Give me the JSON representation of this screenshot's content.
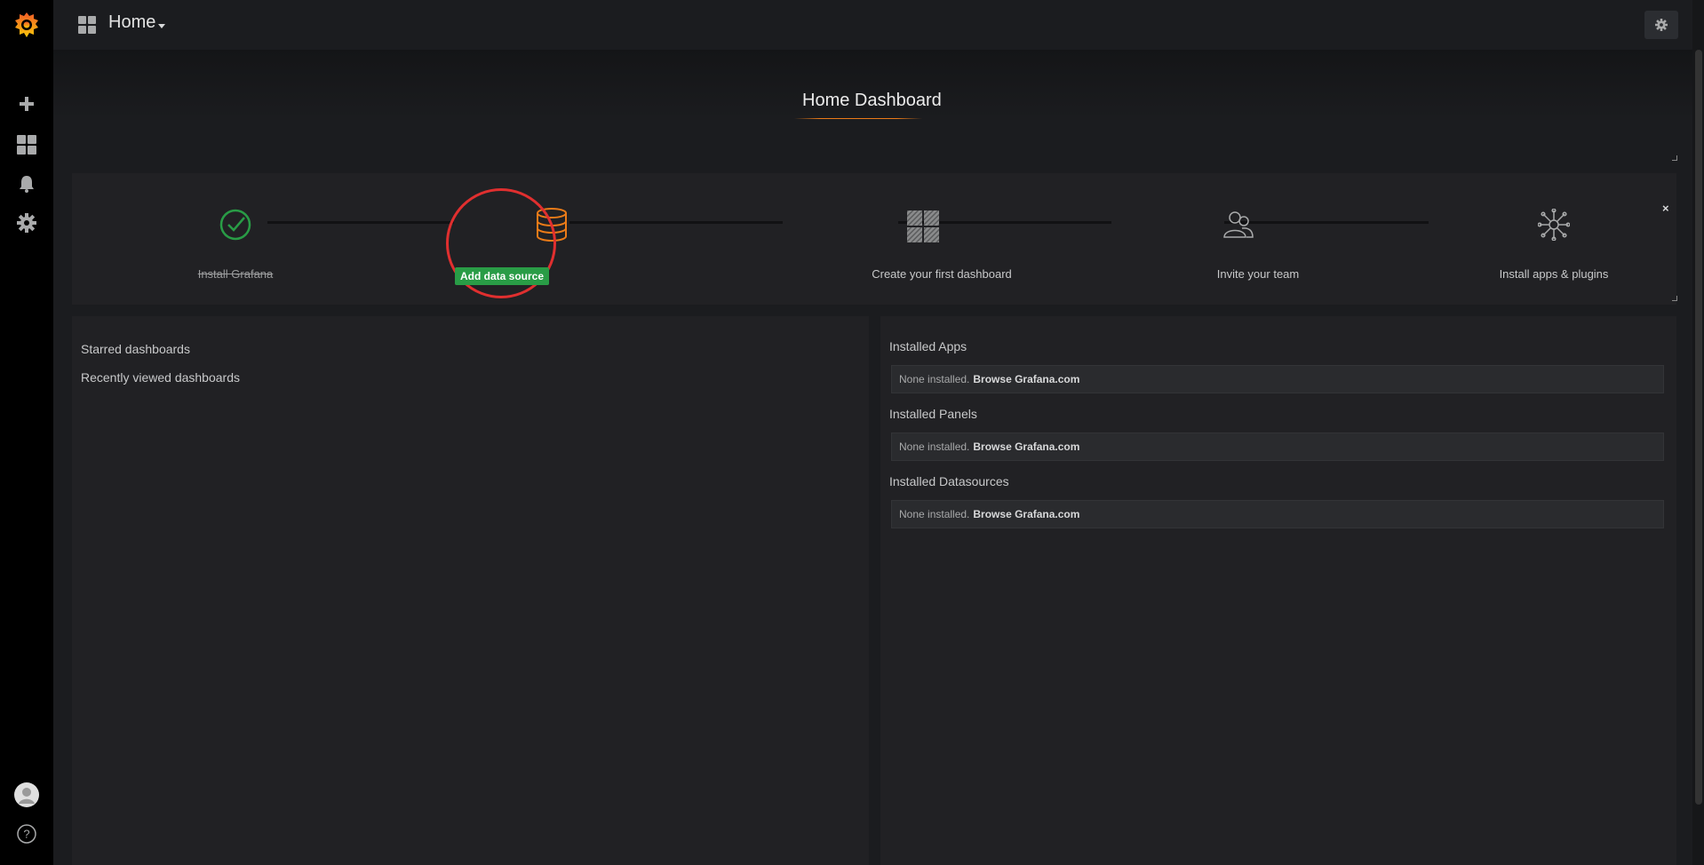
{
  "topbar": {
    "title": "Home"
  },
  "home": {
    "title": "Home Dashboard"
  },
  "onboarding": {
    "steps": [
      {
        "label": "Install Grafana",
        "icon": "check-circle-icon",
        "done": true
      },
      {
        "label": "Add data source",
        "icon": "database-icon",
        "active": true
      },
      {
        "label": "Create your first dashboard",
        "icon": "dashboard-grid-icon"
      },
      {
        "label": "Invite your team",
        "icon": "users-icon"
      },
      {
        "label": "Install apps & plugins",
        "icon": "plugins-icon"
      }
    ],
    "close_label": "×"
  },
  "left_panel": {
    "starred": "Starred dashboards",
    "recent": "Recently viewed dashboards"
  },
  "right_panel": {
    "sections": [
      {
        "title": "Installed Apps",
        "none": "None installed.",
        "link": "Browse Grafana.com"
      },
      {
        "title": "Installed Panels",
        "none": "None installed.",
        "link": "Browse Grafana.com"
      },
      {
        "title": "Installed Datasources",
        "none": "None installed.",
        "link": "Browse Grafana.com"
      }
    ]
  },
  "colors": {
    "brand": "#eb7b18",
    "success": "#299c46",
    "highlight": "#e02f2f",
    "sidebar_bg": "#000000",
    "panel_bg": "#212124"
  }
}
